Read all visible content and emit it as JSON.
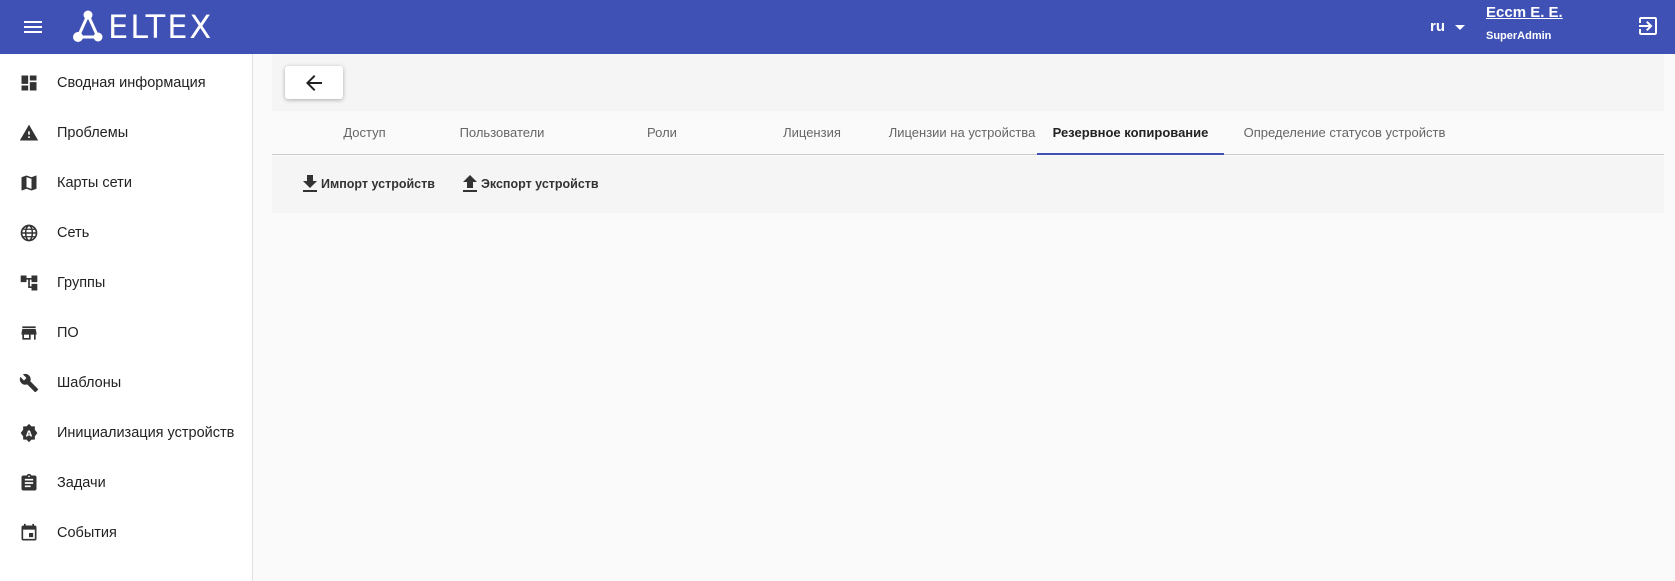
{
  "header": {
    "brand": "ELTEX",
    "lang": "ru",
    "user_name": "Eccm E. E.",
    "user_role": "SuperAdmin",
    "bg_color": "#3f51b5"
  },
  "sidebar": {
    "items": [
      {
        "label": "Сводная информация",
        "icon": "dashboard-icon"
      },
      {
        "label": "Проблемы",
        "icon": "warning-icon"
      },
      {
        "label": "Карты сети",
        "icon": "map-icon"
      },
      {
        "label": "Сеть",
        "icon": "globe-icon"
      },
      {
        "label": "Группы",
        "icon": "hierarchy-icon"
      },
      {
        "label": "ПО",
        "icon": "store-icon"
      },
      {
        "label": "Шаблоны",
        "icon": "wrench-icon"
      },
      {
        "label": "Инициализация устройств",
        "icon": "init-icon"
      },
      {
        "label": "Задачи",
        "icon": "clipboard-icon"
      },
      {
        "label": "События",
        "icon": "calendar-icon"
      }
    ]
  },
  "tabs": [
    {
      "label": "Доступ"
    },
    {
      "label": "Пользователи"
    },
    {
      "label": "Роли"
    },
    {
      "label": "Лицензия"
    },
    {
      "label": "Лицензии на устройства"
    },
    {
      "label": "Резервное копирование",
      "active": true
    },
    {
      "label": "Определение статусов устройств"
    }
  ],
  "actions": {
    "import_label": "Импорт устройств",
    "export_label": "Экспорт устройств"
  }
}
